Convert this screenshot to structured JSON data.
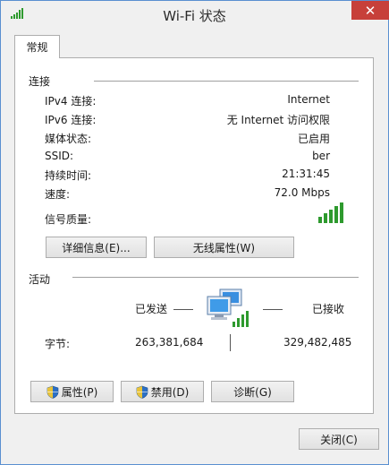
{
  "window": {
    "title": "Wi-Fi 状态",
    "close_glyph": "✕"
  },
  "tab": {
    "label": "常规"
  },
  "connection": {
    "section_title": "连接",
    "rows": [
      {
        "label": "IPv4 连接:",
        "value": "Internet"
      },
      {
        "label": "IPv6 连接:",
        "value": "无 Internet 访问权限"
      },
      {
        "label": "媒体状态:",
        "value": "已启用"
      },
      {
        "label": "SSID:",
        "value": "ber"
      },
      {
        "label": "持续时间:",
        "value": "21:31:45"
      },
      {
        "label": "速度:",
        "value": "72.0 Mbps"
      }
    ],
    "signal_label": "信号质量:",
    "signal_bars": 5,
    "details_button": "详细信息(E)...",
    "wireless_props_button": "无线属性(W)"
  },
  "activity": {
    "section_title": "活动",
    "sent_label": "已发送",
    "received_label": "已接收",
    "bytes_label": "字节:",
    "bytes_sent": "263,381,684",
    "bytes_received": "329,482,485"
  },
  "buttons": {
    "properties": "属性(P)",
    "disable": "禁用(D)",
    "diagnose": "诊断(G)",
    "close": "关闭(C)"
  },
  "colors": {
    "signal_green": "#2e9a2e",
    "close_red": "#c7403a",
    "border_blue": "#5a8fd0"
  }
}
